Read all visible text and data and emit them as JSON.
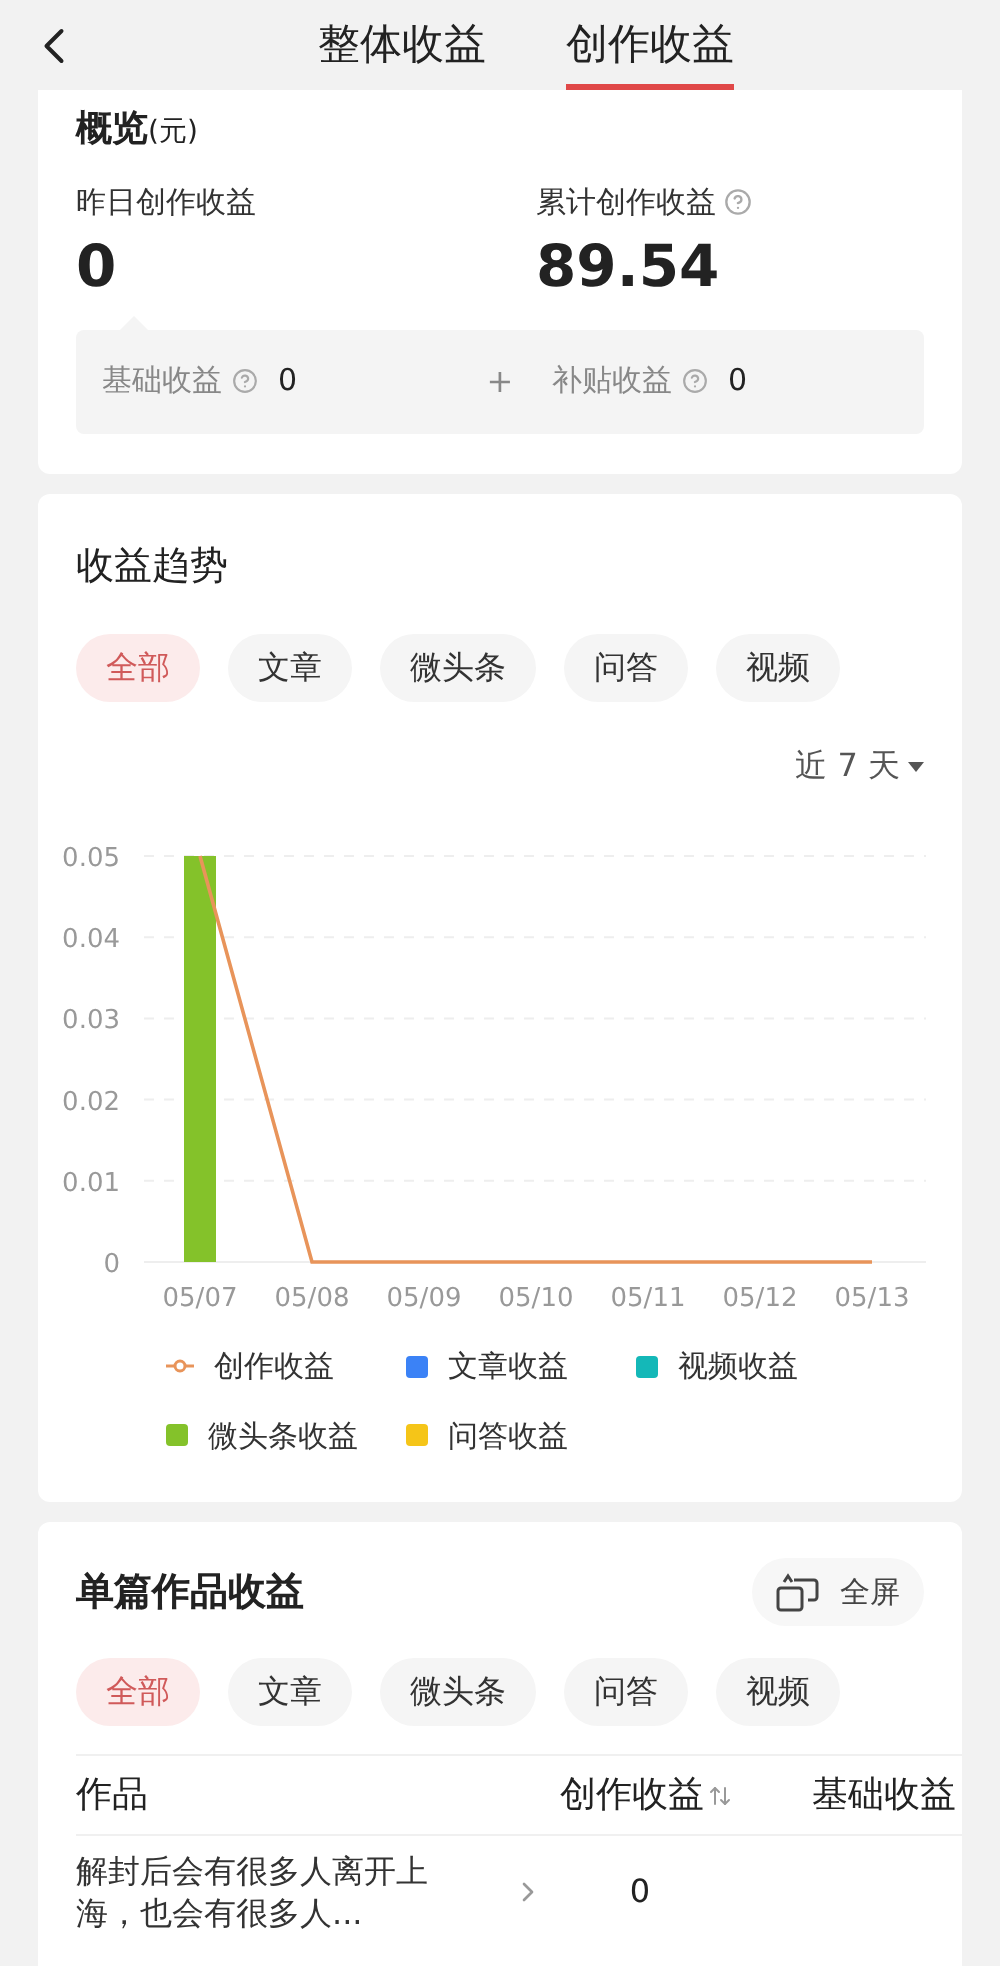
{
  "header": {
    "tabs": [
      {
        "label": "整体收益",
        "selected": false
      },
      {
        "label": "创作收益",
        "selected": true
      }
    ]
  },
  "overview": {
    "title": "概览",
    "unit": "(元)",
    "yesterday": {
      "label": "昨日创作收益",
      "value": "0"
    },
    "total": {
      "label": "累计创作收益",
      "value": "89.54"
    },
    "breakdown": [
      {
        "label": "基础收益",
        "value": "0"
      },
      {
        "label": "补贴收益",
        "value": "0"
      }
    ],
    "operator": "+"
  },
  "trend": {
    "title": "收益趋势",
    "filters": [
      {
        "label": "全部",
        "selected": true
      },
      {
        "label": "文章",
        "selected": false
      },
      {
        "label": "微头条",
        "selected": false
      },
      {
        "label": "问答",
        "selected": false
      },
      {
        "label": "视频",
        "selected": false
      }
    ],
    "range": "近 7 天",
    "chart_data": {
      "type": "bar",
      "grid": true,
      "categories": [
        "05/07",
        "05/08",
        "05/09",
        "05/10",
        "05/11",
        "05/12",
        "05/13"
      ],
      "ylim": [
        0,
        0.05
      ],
      "yticks": [
        0,
        0.01,
        0.02,
        0.03,
        0.04,
        0.05
      ],
      "series": [
        {
          "name": "创作收益",
          "type": "line",
          "color": "#e8945a",
          "values": [
            0.05,
            0,
            0,
            0,
            0,
            0,
            0
          ]
        },
        {
          "name": "文章收益",
          "color": "#3b82f6",
          "values": [
            0,
            0,
            0,
            0,
            0,
            0,
            0
          ]
        },
        {
          "name": "视频收益",
          "color": "#14b8b8",
          "values": [
            0,
            0,
            0,
            0,
            0,
            0,
            0
          ]
        },
        {
          "name": "微头条收益",
          "color": "#84c22a",
          "values": [
            0.05,
            0,
            0,
            0,
            0,
            0,
            0
          ]
        },
        {
          "name": "问答收益",
          "color": "#f5c518",
          "values": [
            0,
            0,
            0,
            0,
            0,
            0,
            0
          ]
        }
      ]
    }
  },
  "works": {
    "title": "单篇作品收益",
    "fullscreen": "全屏",
    "filters": [
      {
        "label": "全部",
        "selected": true
      },
      {
        "label": "文章",
        "selected": false
      },
      {
        "label": "微头条",
        "selected": false
      },
      {
        "label": "问答",
        "selected": false
      },
      {
        "label": "视频",
        "selected": false
      }
    ],
    "table": {
      "columns": [
        "作品",
        "创作收益",
        "基础收益"
      ],
      "rows": [
        {
          "title": "解封后会有很多人离开上海，也会有很多人...",
          "earnings": "0"
        }
      ]
    }
  }
}
